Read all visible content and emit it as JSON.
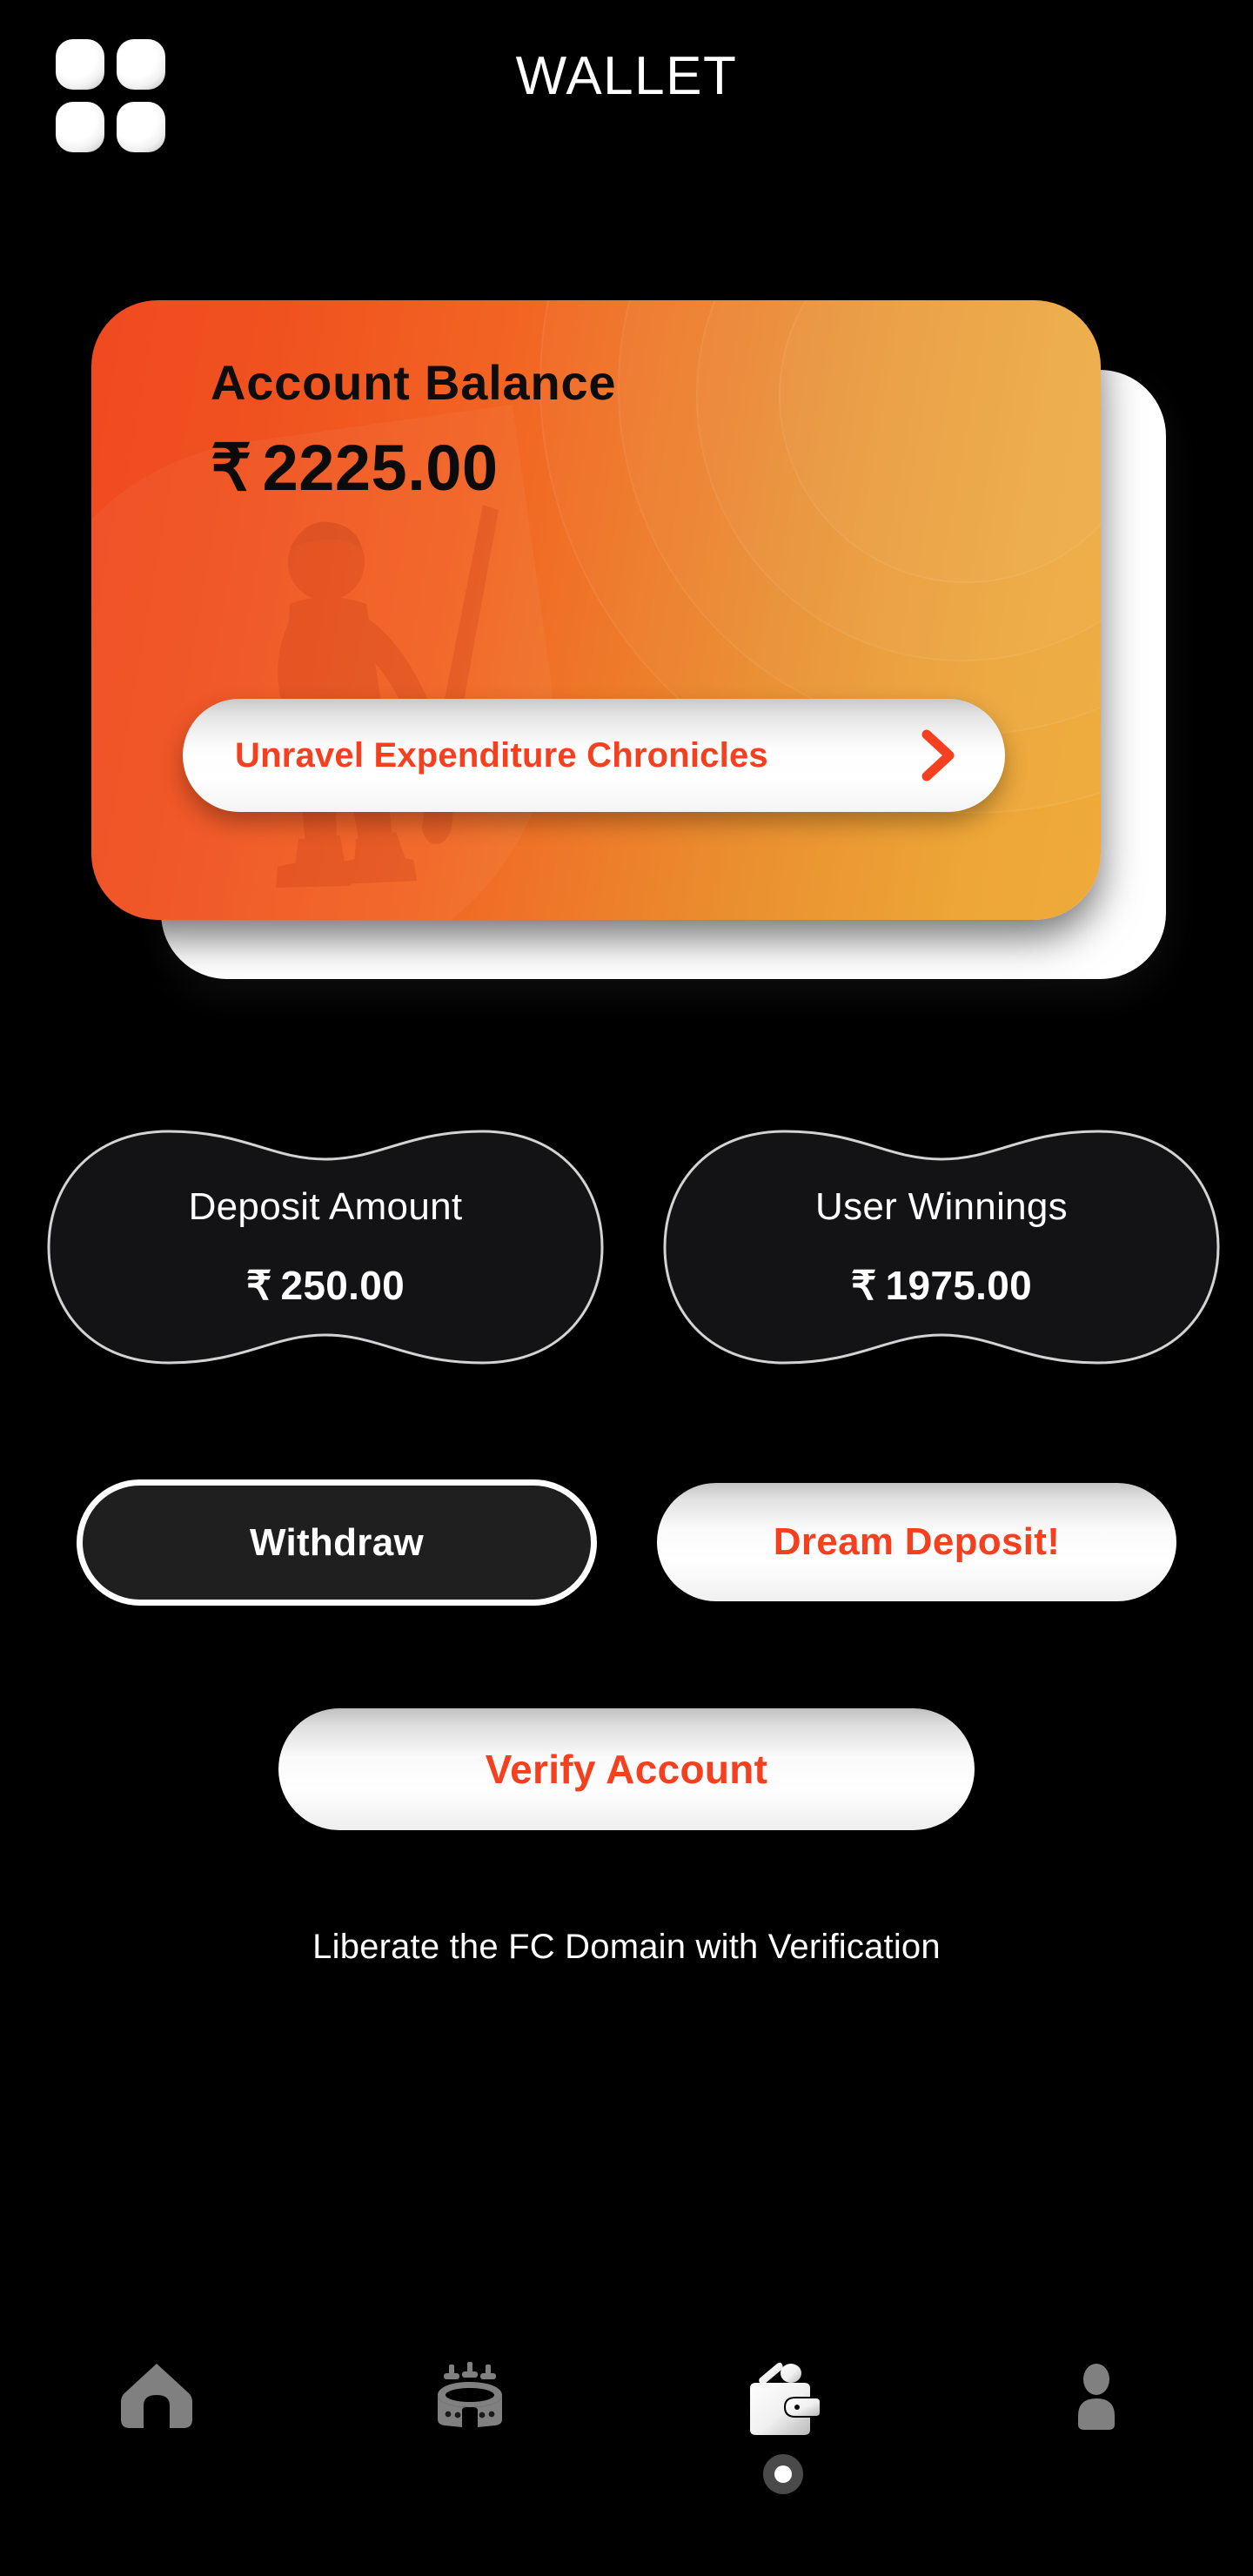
{
  "header": {
    "title": "WALLET",
    "menu_icon": "grid-menu-icon"
  },
  "balance_card": {
    "label": "Account Balance",
    "currency_symbol": "₹",
    "amount": "2225.00",
    "cta_label": "Unravel Expenditure Chronicles",
    "cta_icon": "chevron-right-icon",
    "gradient_from": "#F04A20",
    "gradient_to": "#EFAB39",
    "cta_text_color": "#F4401F",
    "backdrop_color": "#FFFFFF"
  },
  "stats": [
    {
      "name": "deposit-amount",
      "label": "Deposit Amount",
      "currency_symbol": "₹",
      "value": "250.00"
    },
    {
      "name": "user-winnings",
      "label": "User Winnings",
      "currency_symbol": "₹",
      "value": "1975.00"
    }
  ],
  "actions": {
    "withdraw_label": "Withdraw",
    "deposit_label": "Dream Deposit!",
    "verify_label": "Verify Account",
    "verify_caption": "Liberate the FC Domain with Verification",
    "accent_color": "#F4401F"
  },
  "bottom_nav": {
    "active_index": 2,
    "items": [
      {
        "name": "home",
        "icon": "home-icon",
        "active": false
      },
      {
        "name": "stadium",
        "icon": "stadium-icon",
        "active": false
      },
      {
        "name": "wallet",
        "icon": "wallet-icon",
        "active": true
      },
      {
        "name": "profile",
        "icon": "person-icon",
        "active": false
      }
    ],
    "inactive_color": "#808080",
    "active_color": "#FFFFFF"
  }
}
